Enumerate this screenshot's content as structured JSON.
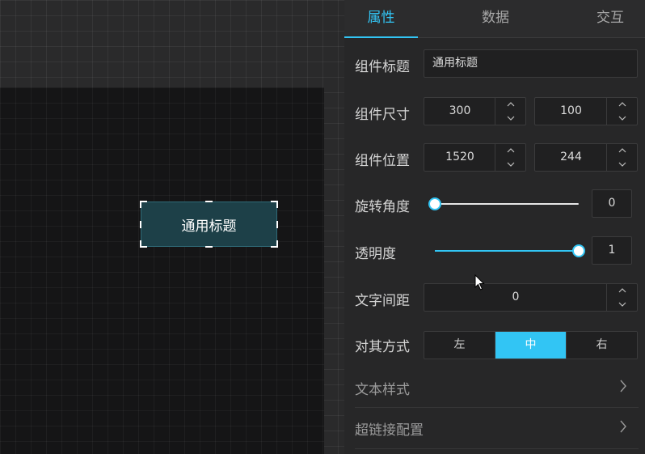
{
  "canvas": {
    "widget_text": "通用标题"
  },
  "tabs": [
    {
      "label": "属性",
      "active": true
    },
    {
      "label": "数据",
      "active": false
    },
    {
      "label": "交互",
      "active": false
    }
  ],
  "props": {
    "title": {
      "label": "组件标题",
      "value": "通用标题"
    },
    "size": {
      "label": "组件尺寸",
      "width": "300",
      "height": "100"
    },
    "position": {
      "label": "组件位置",
      "x": "1520",
      "y": "244"
    },
    "rotation": {
      "label": "旋转角度",
      "value": "0",
      "level": 0
    },
    "opacity": {
      "label": "透明度",
      "value": "1",
      "level": 1
    },
    "letter_spacing": {
      "label": "文字间距",
      "value": "0"
    },
    "align": {
      "label": "对其方式",
      "options": [
        "左",
        "中",
        "右"
      ],
      "selected": "中"
    },
    "text_style": {
      "label": "文本样式"
    },
    "hyperlink": {
      "label": "超链接配置"
    }
  },
  "icons": {
    "step_up": "chevron-up-icon",
    "step_down": "chevron-down-icon",
    "expand": "chevron-right-icon",
    "cursor": "mouse-pointer-icon"
  },
  "colors": {
    "accent": "#32c5f4",
    "panel": "#272728",
    "widget_bg": "#1d4048"
  }
}
